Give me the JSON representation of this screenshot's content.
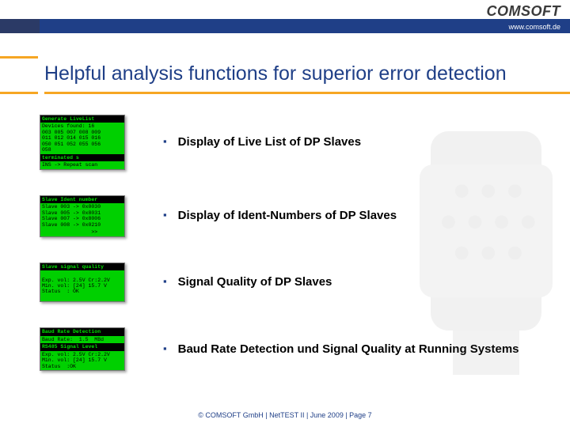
{
  "logo": {
    "text": "COMSOFT",
    "url": "www.comsoft.de"
  },
  "title": "Helpful analysis functions for superior error detection",
  "items": [
    {
      "label": "Display of Live List of DP Slaves",
      "screen": {
        "bar1": "Generate LiveList",
        "body1": "Devices found: 16\n003 005 007 008 009\n011 012 014 015 016\n050 051 052 055 056\n058",
        "bar2": "terminated s",
        "body2": "INS -> Repeat scan"
      }
    },
    {
      "label": "Display of Ident-Numbers of DP Slaves",
      "screen": {
        "bar1": "Slave Ident number",
        "body1": "Slave 003 -> 0x0030\nSlave 005 -> 0x8031\nSlave 007 -> 0x8006\nSlave 008 -> 0x0210",
        "bar2": "",
        "body2": "                >>"
      }
    },
    {
      "label": "Signal Quality of DP Slaves",
      "screen": {
        "bar1": "Slave signal quality",
        "body1": "\nExp. vol: 2.5V Cr:2.2V\nMin. vol: [24] 15.7 V\nStatus  : OK\n ",
        "bar2": "",
        "body2": ""
      }
    },
    {
      "label": "Baud Rate Detection und Signal Quality at Running Systems",
      "screen": {
        "bar1": "Baud Rate Detection",
        "body1": "Baud Rate:  1.5  MBd",
        "bar2": "RS485 Signal Level",
        "body2": "Exp. vol: 2.5V Cr:2.2V\nMin. vol: [24] 15.7 V\nStatus  :OK"
      }
    }
  ],
  "footer": "© COMSOFT GmbH | NetTEST II | June 2009 | Page 7"
}
